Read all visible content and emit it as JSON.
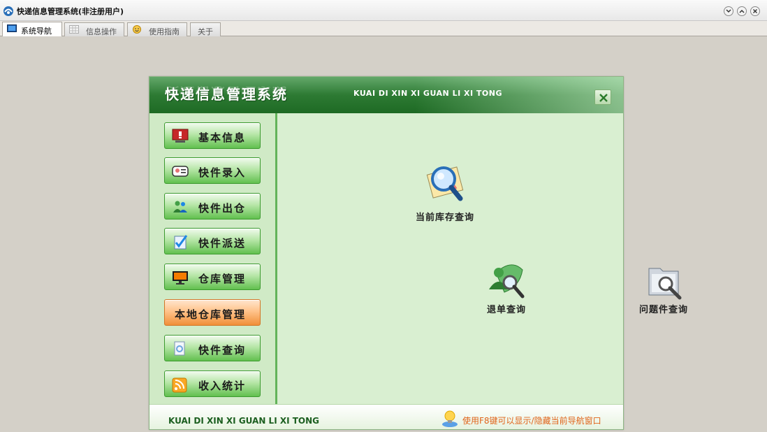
{
  "window": {
    "title": "快递信息管理系统(非注册用户)"
  },
  "tabs": [
    {
      "label": "系统导航",
      "active": true
    },
    {
      "label": "信息操作",
      "active": false
    },
    {
      "label": "使用指南",
      "active": false
    },
    {
      "label": "关于",
      "active": false
    }
  ],
  "panel": {
    "title_cn": "快递信息管理系统",
    "title_en": "KUAI DI XIN XI GUAN LI XI TONG",
    "footer_en": "KUAI DI XIN XI GUAN LI XI TONG",
    "hint": "使用F8键可以显示/隐藏当前导航窗口"
  },
  "nav": [
    {
      "label": "基本信息",
      "icon": "alert-monitor-icon"
    },
    {
      "label": "快件录入",
      "icon": "contact-card-icon"
    },
    {
      "label": "快件出仓",
      "icon": "people-out-icon"
    },
    {
      "label": "快件派送",
      "icon": "check-document-icon"
    },
    {
      "label": "仓库管理",
      "icon": "warehouse-monitor-icon"
    },
    {
      "label": "本地仓库管理",
      "icon": "",
      "active": true
    },
    {
      "label": "快件查询",
      "icon": "search-document-icon"
    },
    {
      "label": "收入统计",
      "icon": "rss-icon"
    }
  ],
  "functions": {
    "stock_query": "当前库存查询",
    "return_query": "退单查询",
    "problem_query": "问题件查询"
  },
  "colors": {
    "header_green": "#2d7a33",
    "panel_bg": "#d9efd1",
    "nav_green": "#62c04f",
    "nav_active_orange": "#f08f39",
    "hint_orange": "#e0641a"
  }
}
